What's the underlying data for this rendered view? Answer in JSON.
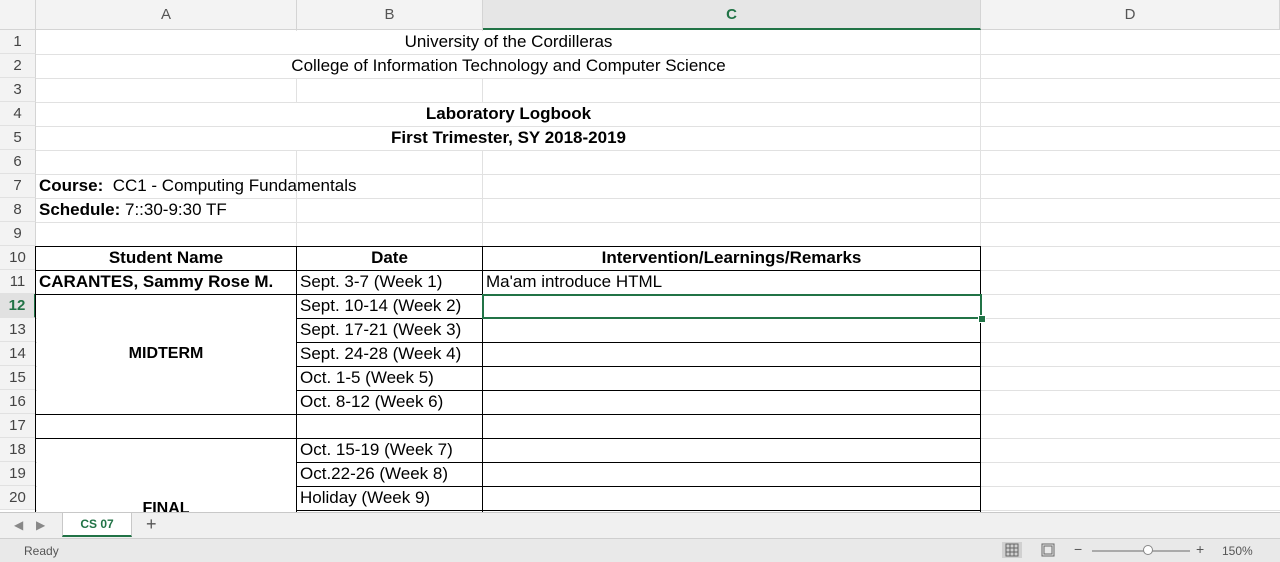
{
  "columns": [
    "A",
    "B",
    "C",
    "D"
  ],
  "selected_column": "C",
  "rows": [
    "1",
    "2",
    "3",
    "4",
    "5",
    "6",
    "7",
    "8",
    "9",
    "10",
    "11",
    "12",
    "13",
    "14",
    "15",
    "16",
    "17",
    "18",
    "19",
    "20"
  ],
  "selected_row": "12",
  "cells": {
    "title1": "University of the Cordilleras",
    "title2": "College of Information Technology and Computer Science",
    "title4": "Laboratory Logbook",
    "title5": "First Trimester, SY 2018-2019",
    "course_label": "Course:",
    "course_value": "CC1 - Computing Fundamentals",
    "schedule_label": "Schedule:",
    "schedule_value": "7::30-9:30 TF",
    "header_name": "Student Name",
    "header_date": "Date",
    "header_remarks": "Intervention/Learnings/Remarks",
    "student_name": "CARANTES, Sammy Rose M.",
    "midterm": "MIDTERM",
    "final": "FINAL",
    "dates": [
      "Sept. 3-7 (Week 1)",
      "Sept. 10-14 (Week 2)",
      "Sept. 17-21 (Week 3)",
      "Sept. 24-28 (Week 4)",
      "Oct. 1-5 (Week 5)",
      "Oct. 8-12 (Week 6)",
      "",
      "Oct. 15-19 (Week 7)",
      "Oct.22-26 (Week 8)",
      "Holiday (Week 9)"
    ],
    "remark_week1": "Ma'am introduce HTML"
  },
  "tabs": {
    "active_sheet": "CS 07",
    "add_label": "+",
    "prev_icon": "triangle-left-icon",
    "next_icon": "triangle-right-icon"
  },
  "status": {
    "ready": "Ready",
    "zoom": "150%",
    "zoom_out": "−",
    "zoom_in": "+"
  },
  "colors": {
    "accent": "#217346"
  }
}
